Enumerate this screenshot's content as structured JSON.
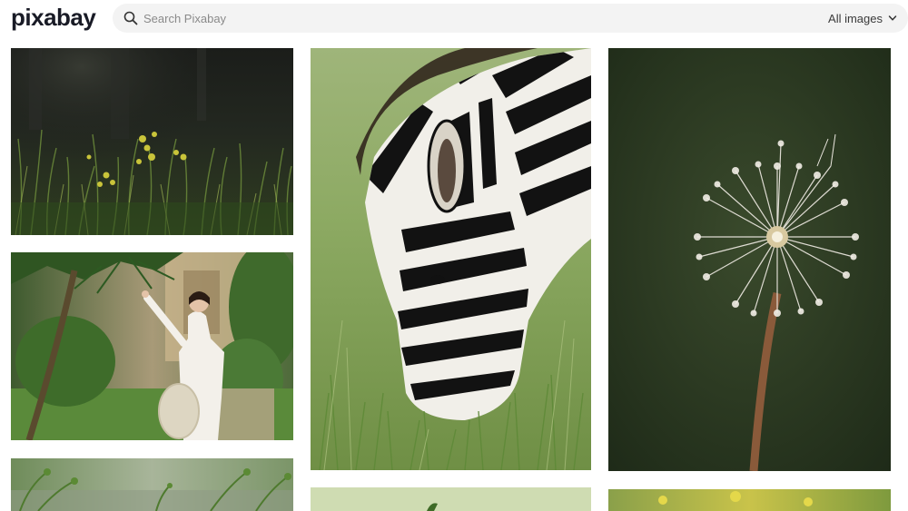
{
  "header": {
    "logo_text": "pixabay",
    "search": {
      "placeholder": "Search Pixabay"
    },
    "filter": {
      "label": "All images"
    }
  },
  "gallery": {
    "images": [
      {
        "subject": "wild grass with small yellow flowers, dark forest background"
      },
      {
        "subject": "young woman in white traditional dress holding a straw hat in a garden"
      },
      {
        "subject": "zebra grazing in tall green grass"
      },
      {
        "subject": "dandelion seed head on a dark green background"
      },
      {
        "subject": "green plants, partially visible"
      },
      {
        "subject": "pale green leaves, partially visible"
      },
      {
        "subject": "yellow flowers field, partially visible"
      }
    ]
  },
  "colors": {
    "logo": "#191b26",
    "search_bg": "#f3f3f3",
    "placeholder": "#8a8a8a"
  }
}
